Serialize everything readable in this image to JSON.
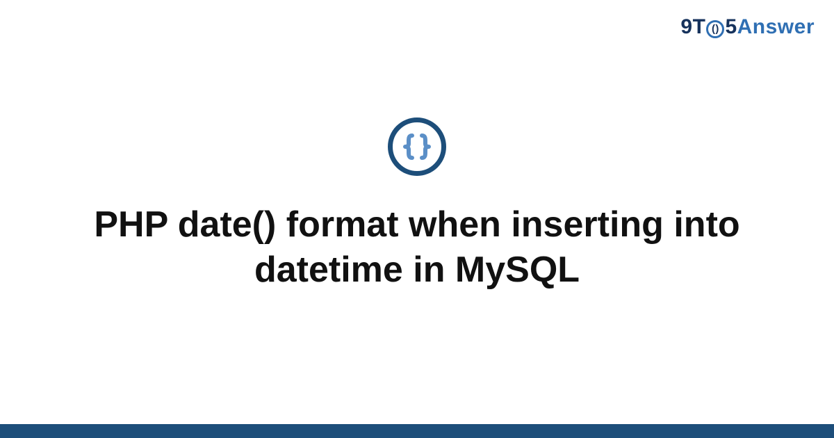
{
  "brand": {
    "part1": "9T",
    "clock_inner": "()",
    "part2": "5",
    "part3": "Answer"
  },
  "icon": {
    "name": "code-braces-icon",
    "ring_color": "#1d4e7a",
    "brace_color": "#5b8fc7"
  },
  "title": "PHP date() format when inserting into datetime in MySQL",
  "footer_color": "#1d4e7a"
}
